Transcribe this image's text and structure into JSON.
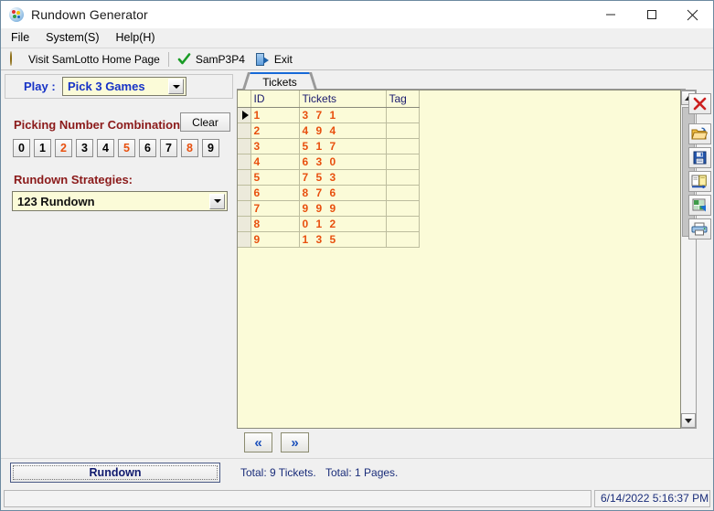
{
  "window": {
    "title": "Rundown Generator",
    "app_icon": "lottery-ball-icon",
    "controls": {
      "minimize": "minimize-icon",
      "maximize": "maximize-icon",
      "close": "close-icon"
    }
  },
  "menubar": {
    "items": [
      {
        "label": "File"
      },
      {
        "label": "System(S)"
      },
      {
        "label": "Help(H)"
      }
    ]
  },
  "toolbar": {
    "items": [
      {
        "label": "Visit SamLotto Home Page",
        "icon": "globe-icon"
      },
      {
        "label": "SamP3P4",
        "icon": "check-icon"
      },
      {
        "label": "Exit",
        "icon": "exit-door-icon"
      }
    ]
  },
  "left_panel": {
    "play": {
      "label": "Play :",
      "selected": "Pick 3 Games"
    },
    "picking": {
      "label": "Picking Number Combination:",
      "clear_label": "Clear",
      "numbers": [
        {
          "value": "0",
          "selected": false
        },
        {
          "value": "1",
          "selected": false
        },
        {
          "value": "2",
          "selected": true
        },
        {
          "value": "3",
          "selected": false
        },
        {
          "value": "4",
          "selected": false
        },
        {
          "value": "5",
          "selected": true
        },
        {
          "value": "6",
          "selected": false
        },
        {
          "value": "7",
          "selected": false
        },
        {
          "value": "8",
          "selected": true
        },
        {
          "value": "9",
          "selected": false
        }
      ]
    },
    "strategies": {
      "label": "Rundown Strategies:",
      "selected": "123 Rundown"
    }
  },
  "tabs": [
    {
      "label": "Tickets",
      "active": true
    }
  ],
  "grid": {
    "columns": [
      "ID",
      "Tickets",
      "Tag"
    ],
    "rows": [
      {
        "id": "1",
        "tickets": "3 7 1",
        "tag": "",
        "selected": true
      },
      {
        "id": "2",
        "tickets": "4 9 4",
        "tag": "",
        "selected": false
      },
      {
        "id": "3",
        "tickets": "5 1 7",
        "tag": "",
        "selected": false
      },
      {
        "id": "4",
        "tickets": "6 3 0",
        "tag": "",
        "selected": false
      },
      {
        "id": "5",
        "tickets": "7 5 3",
        "tag": "",
        "selected": false
      },
      {
        "id": "6",
        "tickets": "8 7 6",
        "tag": "",
        "selected": false
      },
      {
        "id": "7",
        "tickets": "9 9 9",
        "tag": "",
        "selected": false
      },
      {
        "id": "8",
        "tickets": "0 1 2",
        "tag": "",
        "selected": false
      },
      {
        "id": "9",
        "tickets": "1 3 5",
        "tag": "",
        "selected": false
      }
    ]
  },
  "pager": {
    "first_label": "«",
    "last_label": "»"
  },
  "rail": [
    {
      "icon": "delete-x-icon"
    },
    {
      "icon": "open-folder-icon"
    },
    {
      "icon": "save-disk-icon"
    },
    {
      "icon": "export-file-icon"
    },
    {
      "icon": "excel-icon"
    },
    {
      "icon": "print-icon"
    }
  ],
  "footer": {
    "rundown_label": "Rundown",
    "total_tickets": "Total: 9 Tickets.",
    "total_pages": "Total: 1 Pages."
  },
  "statusbar": {
    "left": "",
    "timestamp": "6/14/2022 5:16:37 PM"
  },
  "colors": {
    "accent_blue": "#1733c6",
    "label_red": "#8b1a1a",
    "data_orange": "#e8500f",
    "grid_bg": "#fbfbd8",
    "tab_highlight": "#1669d8"
  }
}
